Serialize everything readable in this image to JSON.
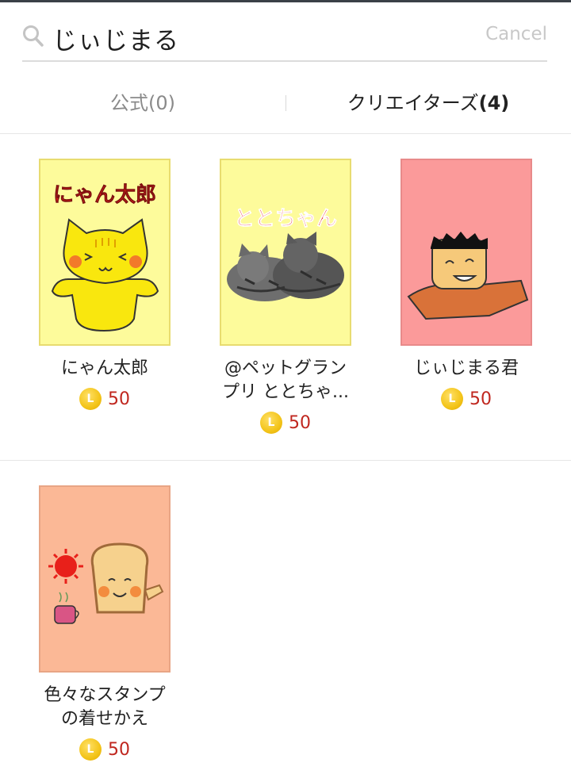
{
  "search": {
    "query": "じぃじまる",
    "cancel_label": "Cancel"
  },
  "tabs": [
    {
      "label": "公式(0)",
      "active": false
    },
    {
      "label_text": "クリエイターズ",
      "count": "(4)",
      "active": true
    }
  ],
  "items": [
    {
      "name": "にゃん太郎",
      "price": "50",
      "coin": "L",
      "thumb_text": "にゃん太郎",
      "thumb_bg": "#fdfb9b"
    },
    {
      "name_line1": "@ペットグラン",
      "name_line2": "プリ ととちゃ...",
      "price": "50",
      "coin": "L",
      "thumb_text": "ととちゃん",
      "thumb_bg": "#fdfb9b"
    },
    {
      "name": "じぃじまる君",
      "price": "50",
      "coin": "L",
      "thumb_bg": "#fb9a9a"
    },
    {
      "name_line1": "色々なスタンプ",
      "name_line2": "の着せかえ",
      "price": "50",
      "coin": "L",
      "thumb_bg": "#fbb896"
    }
  ],
  "colors": {
    "price": "#c0271f",
    "coin": "#f3c419",
    "tab_inactive": "#8a8a8a",
    "cancel": "#c8c8c8"
  }
}
